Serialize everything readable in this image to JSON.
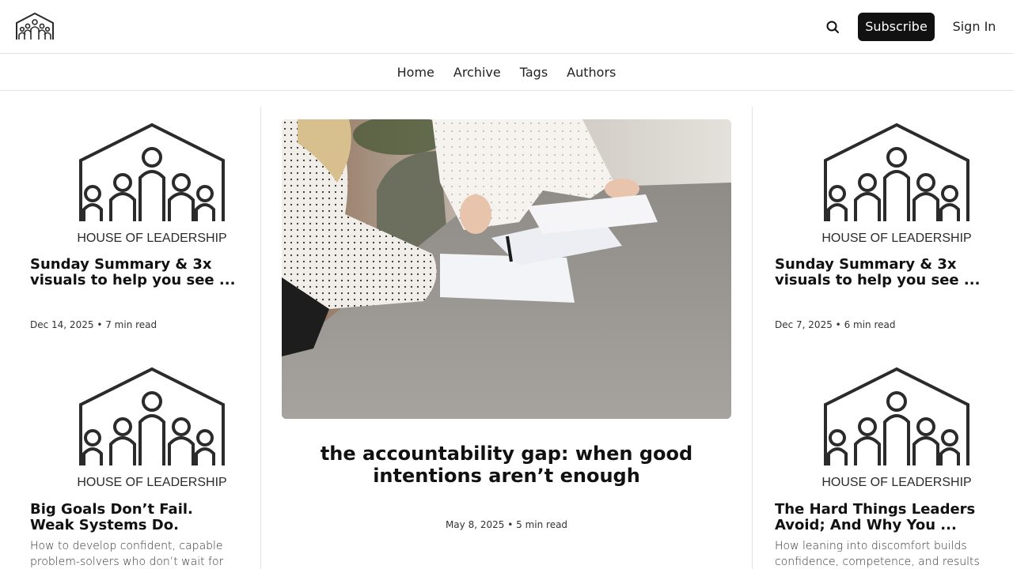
{
  "header": {
    "logo_alt": "House of Leadership logo",
    "search_icon": "search-icon",
    "subscribe_label": "Subscribe",
    "signin_label": "Sign In"
  },
  "nav": {
    "items": [
      "Home",
      "Archive",
      "Tags",
      "Authors"
    ]
  },
  "brand": {
    "wordmark": "HOUSE OF LEADERSHIP"
  },
  "left_column": [
    {
      "title": "Sunday Summary & 3x visuals to help you see ...",
      "date": "Dec 14, 2025",
      "read_time": "7 min read",
      "excerpt": ""
    },
    {
      "title": "Big Goals Don’t Fail. Weak Systems Do.",
      "date": "",
      "read_time": "",
      "excerpt": "How to develop confident, capable problem-solvers who don’t wait for you."
    }
  ],
  "featured": {
    "title": "the accountability gap: when good intentions aren’t enough",
    "date": "May 8, 2025",
    "read_time": "5 min read"
  },
  "right_column": [
    {
      "title": "Sunday Summary & 3x visuals to help you see ...",
      "date": "Dec 7, 2025",
      "read_time": "6 min read",
      "excerpt": ""
    },
    {
      "title": "The Hard Things Leaders Avoid; And Why You ...",
      "date": "",
      "read_time": "",
      "excerpt": "How leaning into discomfort builds confidence, competence, and results"
    }
  ],
  "meta_separator": "•",
  "colors": {
    "button_bg": "#111111",
    "button_text": "#ffffff",
    "border": "#e3e3e3",
    "logo_stroke": "#2b2b2b"
  }
}
